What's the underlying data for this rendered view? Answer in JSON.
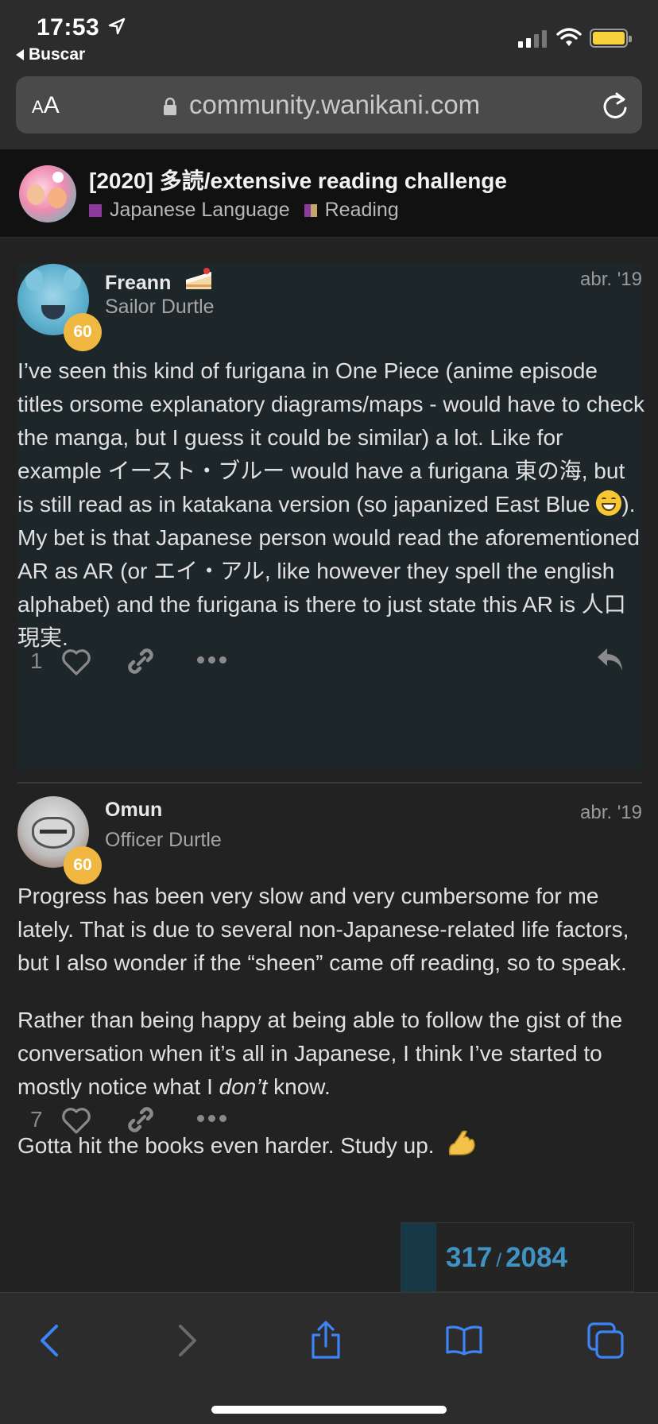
{
  "status_bar": {
    "time": "17:53",
    "back_app": "Buscar",
    "icons": [
      "location-arrow-icon",
      "cellular-signal-icon",
      "wifi-icon",
      "battery-icon"
    ],
    "battery_color": "#f7d23b"
  },
  "browser": {
    "text_size_label_small": "A",
    "text_size_label_large": "A",
    "url": "community.wanikani.com",
    "icons": [
      "lock-icon",
      "reload-icon"
    ]
  },
  "topic": {
    "title": "[2020] 多読/extensive reading challenge",
    "categories": [
      {
        "name": "Japanese Language",
        "color": "#8e3a9d"
      },
      {
        "name": "Reading",
        "color_left": "#8e3a9d",
        "color_right": "#c3a66b"
      }
    ]
  },
  "posts": [
    {
      "username": "Freann",
      "user_title": "Sailor Durtle",
      "level": "60",
      "date": "abr. '19",
      "body": {
        "p1_a": "I’ve seen this kind of furigana in One Piece (anime episode titles orsome explanatory diagrams/maps - would have to check the manga, but I guess it could be similar) a lot. Like for example イースト・ブルー would have a furigana 東の海, but is still read as in katakana version (so japanized East Blue ",
        "p1_b": ").",
        "p2": "My bet is that Japanese person would read the aforementioned AR as AR (or エイ・アル, like however they spell the english alphabet) and the furigana is there to just state this AR is 人口現実."
      },
      "likes": "1"
    },
    {
      "username": "Omun",
      "user_title": "Officer Durtle",
      "level": "60",
      "date": "abr. '19",
      "body": {
        "p1": "Progress has been very slow and very cumbersome for me lately. That is due to several non-Japanese-related life factors, but I also wonder if the “sheen” came off reading, so to speak.",
        "p2_a": "Rather than being happy at being able to follow the gist of the conversation when it’s all in Japanese, I think I’ve started to mostly notice what I ",
        "p2_em": "don’t",
        "p2_b": " know.",
        "p3": "Gotta hit the books even harder. Study up. "
      },
      "likes": "7"
    }
  ],
  "progress": {
    "current": "317",
    "separator": "/",
    "total": "2084",
    "fraction": 0.152,
    "color": "#3f93c3"
  },
  "toolbar": {
    "icons": [
      "back-icon",
      "forward-icon",
      "share-icon",
      "bookmarks-icon",
      "tabs-icon"
    ],
    "accent": "#3d84f7"
  }
}
